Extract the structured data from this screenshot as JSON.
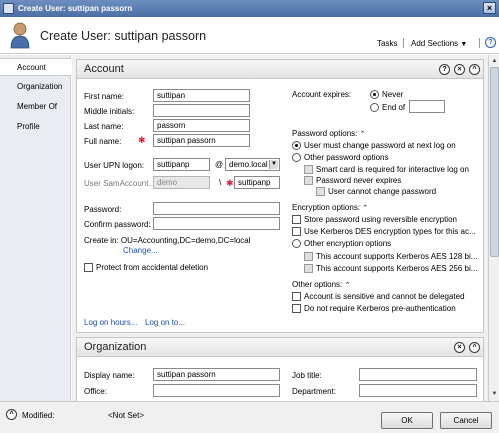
{
  "window": {
    "title": "Create User: suttipan passorn"
  },
  "header": {
    "title": "Create User: suttipan passorn",
    "tasks_label": "Tasks",
    "add_sections_label": "Add Sections",
    "caret": "▼"
  },
  "nav": {
    "items": [
      "Account",
      "Organization",
      "Member Of",
      "Profile"
    ]
  },
  "account": {
    "title": "Account",
    "first_name_label": "First name:",
    "first_name": "suttipan",
    "middle_initials_label": "Middle initials:",
    "middle_initials": "",
    "last_name_label": "Last name:",
    "last_name": "passorn",
    "full_name_label": "Full name:",
    "full_name": "suttipan passorn",
    "upn_label": "User UPN logon:",
    "upn": "suttipanp",
    "at": "@",
    "domain": "demo.local",
    "sam_label": "User SamAccount...",
    "sam_domain": "demo",
    "backslash": "\\",
    "sam": "suttipanp",
    "password_label": "Password:",
    "confirm_password_label": "Confirm password:",
    "create_in": "Create in:  OU=Accounting,DC=demo,DC=local",
    "change_link": "Change...",
    "protect_label": "Protect from accidental deletion",
    "log_on_hours": "Log on hours...",
    "log_on_to": "Log on to...",
    "account_expires_label": "Account expires:",
    "never_label": "Never",
    "end_of_label": "End of",
    "password_options_label": "Password options:",
    "must_change": "User must change password at next log on",
    "other_password_options": "Other password options",
    "smart_card": "Smart card is required for interactive log on",
    "never_expires": "Password never expires",
    "cannot_change": "User cannot change password",
    "encryption_options_label": "Encryption options:",
    "reversible": "Store password using reversible encryption",
    "kerberos_des": "Use Kerberos DES encryption types for this ac...",
    "other_encryption": "Other encryption options",
    "aes128": "This account supports Kerberos AES 128 bi...",
    "aes256": "This account supports Kerberos AES 256 bi...",
    "other_options_label": "Other options:",
    "sensitive": "Account is sensitive and cannot be delegated",
    "no_preauth": "Do not require Kerberos pre-authentication"
  },
  "organization": {
    "title": "Organization",
    "display_name_label": "Display name:",
    "display_name": "suttipan passorn",
    "office_label": "Office:",
    "job_title_label": "Job title:",
    "department_label": "Department:"
  },
  "footer": {
    "modified_label": "Modified:",
    "not_set": "<Not Set>",
    "ok": "OK",
    "cancel": "Cancel"
  },
  "colors": {
    "titlebar": "#4b6ea6",
    "link": "#1b4fb5",
    "required": "#dd2233",
    "nav_bg": "#e9ecf0"
  }
}
